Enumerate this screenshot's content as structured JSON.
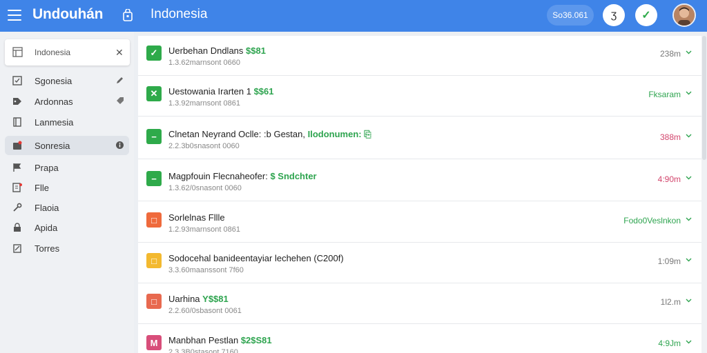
{
  "header": {
    "app_title": "Undouhán",
    "region": "Indonesia",
    "search_chip": "So36.061",
    "btn1_glyph": "ʒ",
    "btn2_glyph": "✓"
  },
  "sidebar": {
    "search": {
      "value": "Indonesia",
      "clear": "✕"
    },
    "items": [
      {
        "label": "Sgonesia",
        "icon": "checkbox-icon",
        "trail": "pencil-icon"
      },
      {
        "label": "Ardonnas",
        "icon": "tag-icon",
        "trail": "label-icon"
      },
      {
        "label": "Lanmesia",
        "icon": "book-icon"
      },
      {
        "label": "Sonresia",
        "icon": "folder-alert-icon",
        "trail": "info-icon",
        "active": true
      },
      {
        "label": "Prapa",
        "icon": "flag-icon"
      },
      {
        "label": "Flle",
        "icon": "document-alert-icon"
      },
      {
        "label": "Flaoia",
        "icon": "wrench-icon"
      },
      {
        "label": "Apida",
        "icon": "lock-icon"
      },
      {
        "label": "Torres",
        "icon": "clipboard-icon"
      }
    ]
  },
  "list": {
    "rows": [
      {
        "title": "Uerbehan Dndlans",
        "highlight": "$$81",
        "sub": "1.3.62marnsont 0660",
        "meta": "238m",
        "meta_color": "#777777",
        "badge_color": "#2eaa4a",
        "badge_glyph": "✓"
      },
      {
        "title": "Uestowania Irarten 1",
        "highlight": "$$61",
        "sub": "1.3.92marnsont 0861",
        "meta": "Fksaram",
        "meta_color": "#2ea44f",
        "badge_color": "#2eaa4a",
        "badge_glyph": "✕"
      },
      {
        "title": "Clnetan Neyrand Oclle: :b Gestan,",
        "highlight": "Ilodonumen: ⎘",
        "sub": "2.2.3b0snasont 0060",
        "meta": "388m",
        "meta_color": "#d2456c",
        "badge_color": "#2eaa4a",
        "badge_glyph": "−"
      },
      {
        "title": "Magpfouin Flecnaheofer:",
        "highlight": "$ Sndchter",
        "sub": "1.3.62/0snasont 0060",
        "meta": "4:90m",
        "meta_color": "#d2456c",
        "badge_color": "#2eaa4a",
        "badge_glyph": "−"
      },
      {
        "title": "Sorlelnas Fllle",
        "highlight": "",
        "sub": "1.2.93marnsont 0861",
        "meta": "Fodo0Veslnkon",
        "meta_color": "#2ea44f",
        "badge_color": "#ef6a3c",
        "badge_glyph": "□"
      },
      {
        "title": "Sodocehal banideentayiar lechehen (C200f)",
        "highlight": "",
        "sub": "3.3.60maanssont 7f60",
        "meta": "1:09m",
        "meta_color": "#777777",
        "badge_color": "#f3b92f",
        "badge_glyph": "□"
      },
      {
        "title": "Uarhina",
        "highlight": "Y$$81",
        "sub": "2.2.60/0sbasont 0061",
        "meta": "1l2.m",
        "meta_color": "#777777",
        "badge_color": "#e8694f",
        "badge_glyph": "□"
      },
      {
        "title": "Manbhan Pestlan",
        "highlight": "$2$S81",
        "sub": "2.3.3B0stasont 7160",
        "meta": "4:9Jm",
        "meta_color": "#2ea44f",
        "badge_color": "#d84e7a",
        "badge_glyph": "M"
      }
    ]
  },
  "colors": {
    "topbar": "#3f84e8",
    "accent_green": "#2ea44f",
    "accent_pink": "#d2456c"
  }
}
